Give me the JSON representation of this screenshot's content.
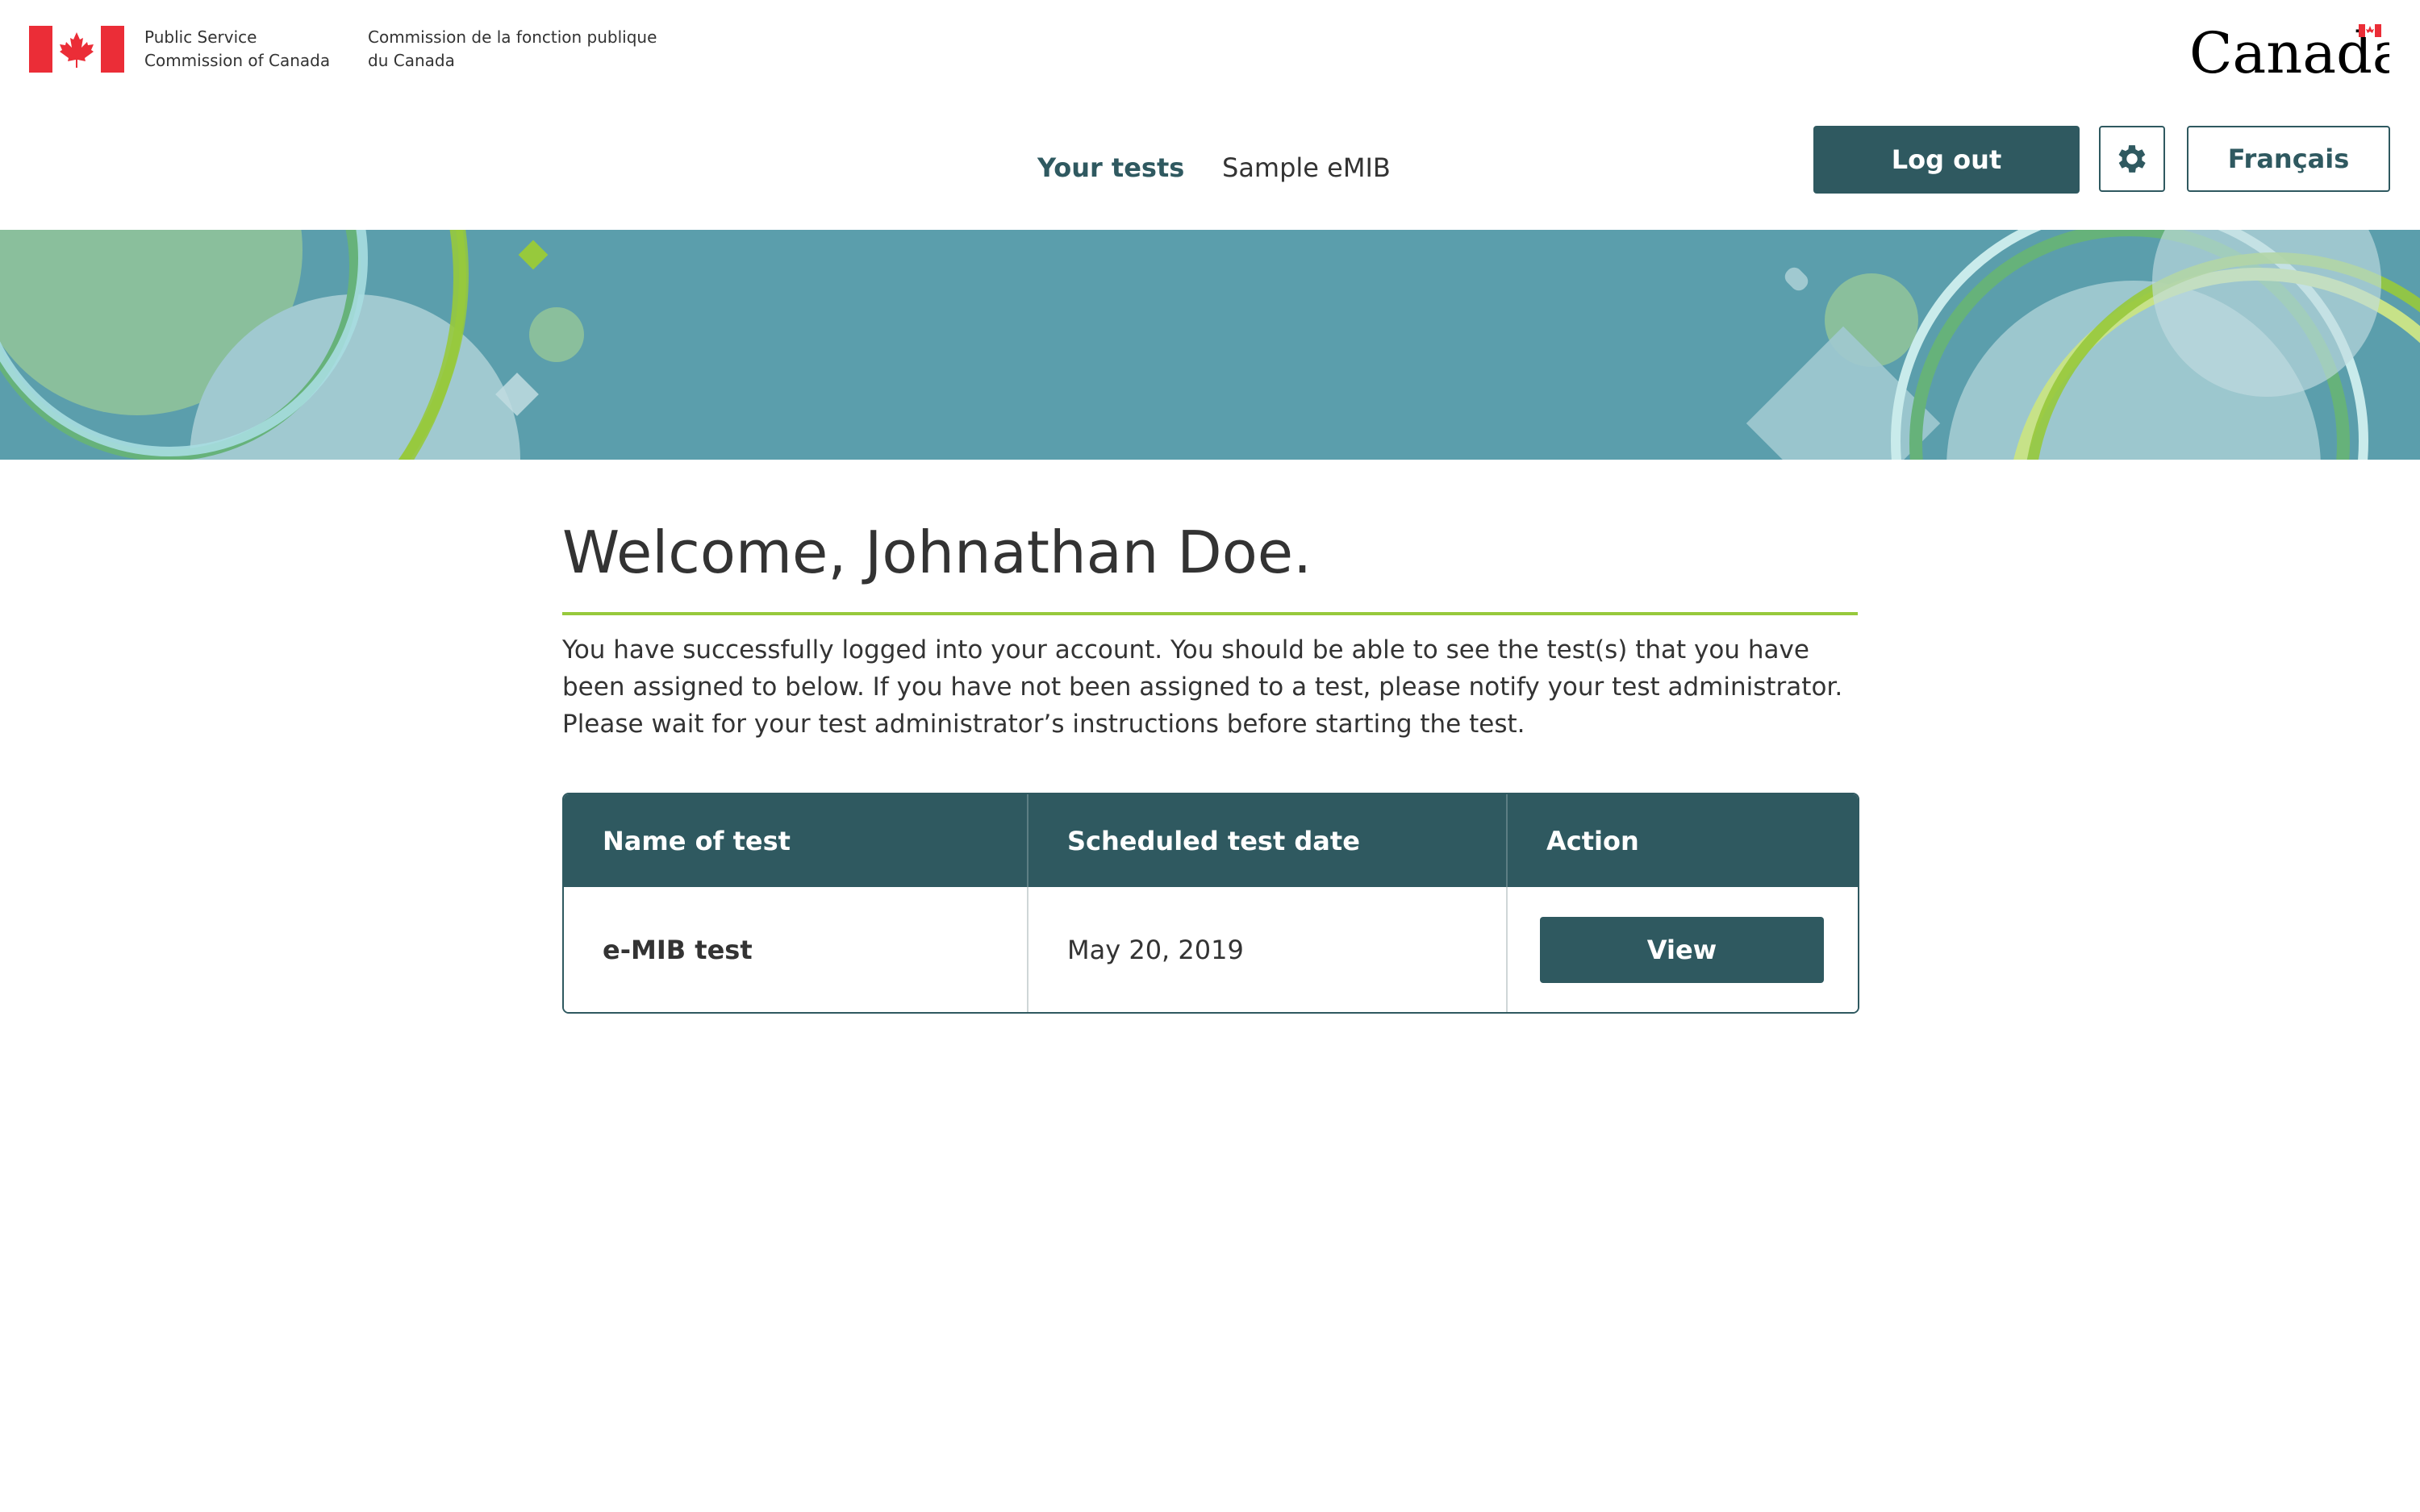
{
  "header": {
    "dept_en": "Public Service Commission of Canada",
    "dept_fr": "Commission de la fonction publique du Canada",
    "wordmark": "Canada",
    "flag_icon": "canada-flag-icon"
  },
  "nav": {
    "links": [
      {
        "label": "Your tests",
        "active": true
      },
      {
        "label": "Sample eMIB",
        "active": false
      }
    ],
    "logout_label": "Log out",
    "settings_icon": "gear-icon",
    "language_label": "Français"
  },
  "main": {
    "title": "Welcome, Johnathan Doe.",
    "intro": "You have successfully logged into your account. You should be able to see the test(s) that you have been assigned to below. If you have not been assigned to a test, please notify your test administrator. Please wait for your test administrator’s instructions before starting the test."
  },
  "table": {
    "headers": [
      "Name of test",
      "Scheduled test date",
      "Action"
    ],
    "rows": [
      {
        "name": "e-MIB test",
        "date": "May 20, 2019",
        "action_label": "View"
      }
    ]
  },
  "colors": {
    "primary": "#2f5960",
    "accent_green": "#97c93c",
    "banner": "#5b9eac",
    "canada_red": "#eb2d37"
  }
}
